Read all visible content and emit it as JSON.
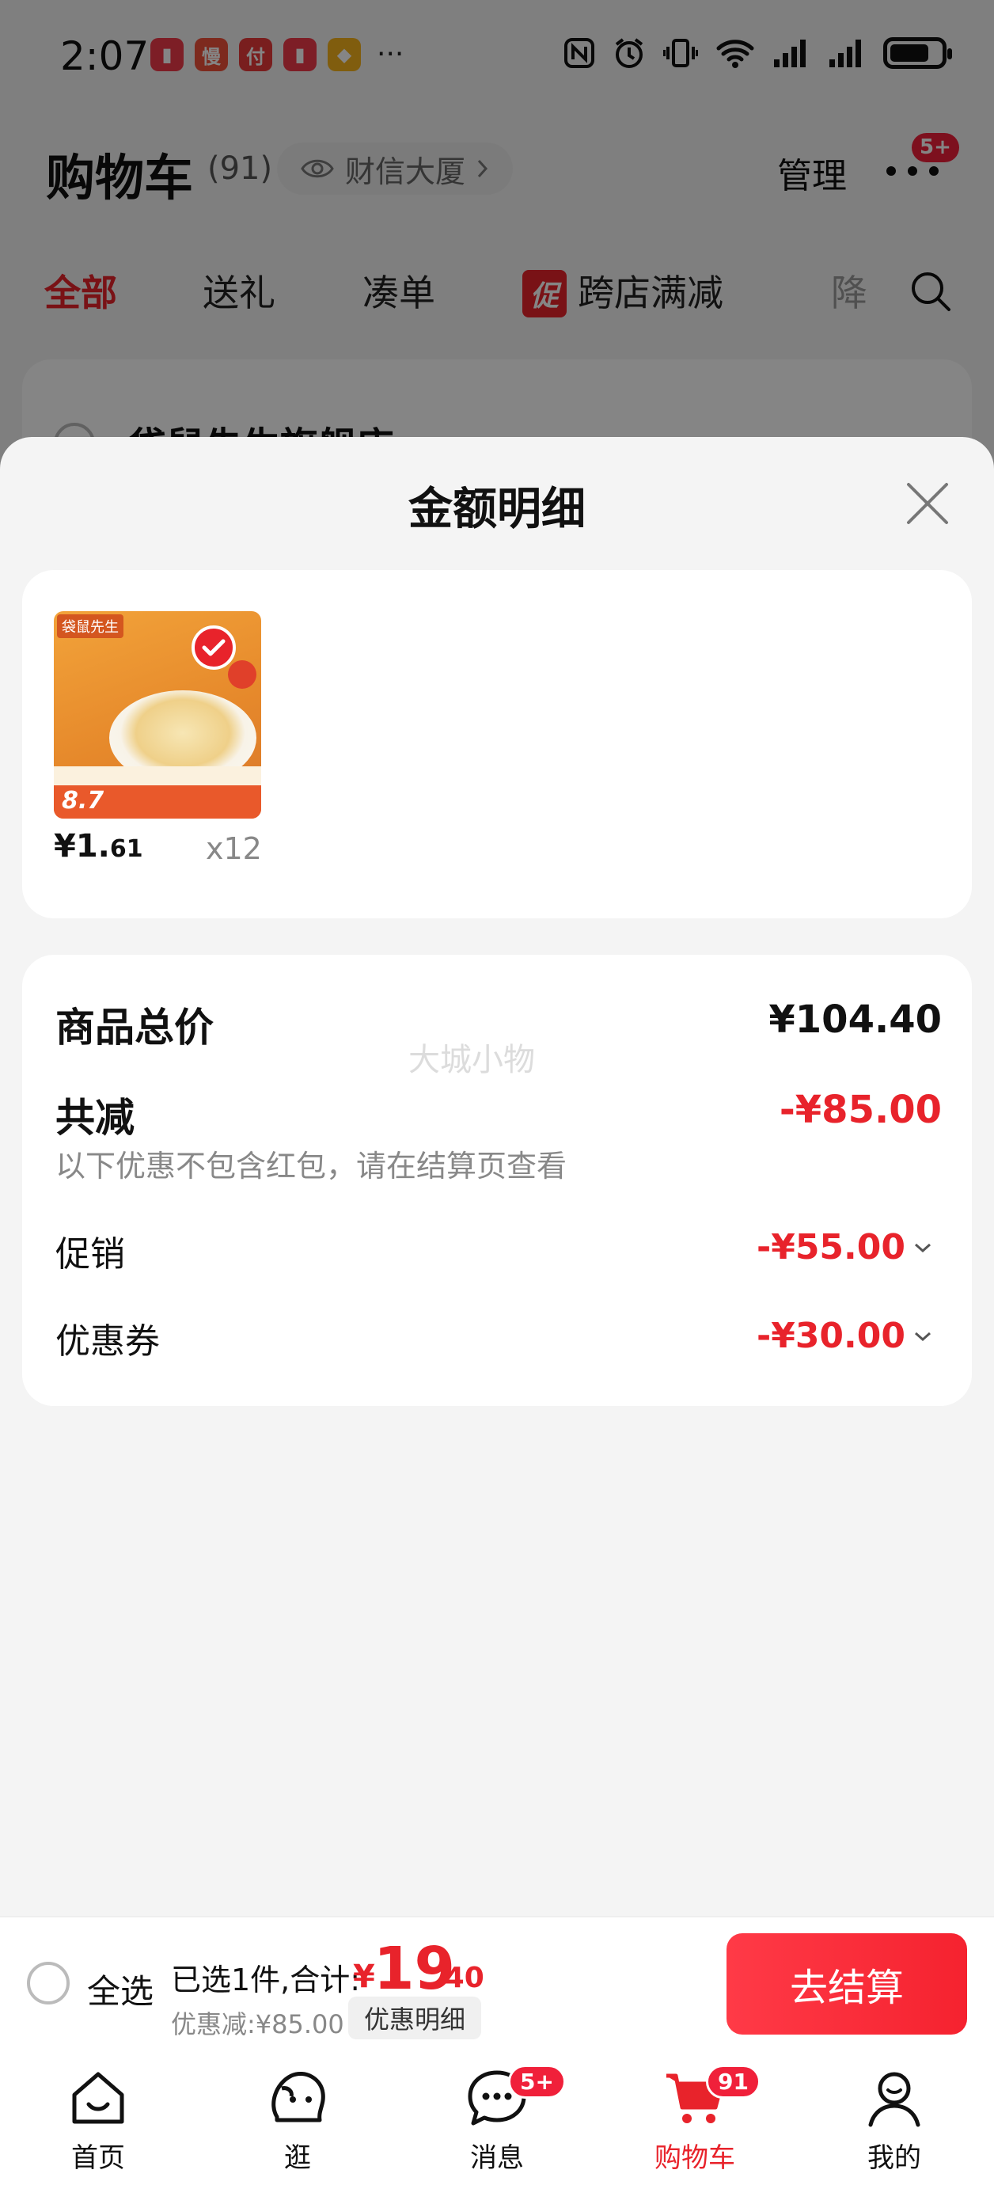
{
  "status_bar": {
    "time": "2:07",
    "app_icons": [
      {
        "name": "book-app-icon",
        "glyph": "▮",
        "color": "#ef3b4a"
      },
      {
        "name": "slow-app-icon",
        "glyph": "慢",
        "color": "#f0523a"
      },
      {
        "name": "pay-app-icon",
        "glyph": "付",
        "color": "#e83a3a"
      },
      {
        "name": "book-app-icon-2",
        "glyph": "▮",
        "color": "#ef3b4a"
      },
      {
        "name": "diamond-app-icon",
        "glyph": "◆",
        "color": "#f5b21c"
      }
    ],
    "more": "···"
  },
  "header": {
    "title": "购物车",
    "count": "(91)",
    "location": "财信大厦",
    "manage": "管理",
    "more_badge": "5+"
  },
  "tabs": [
    {
      "label": "全部",
      "active": true
    },
    {
      "label": "送礼",
      "active": false
    },
    {
      "label": "凑单",
      "active": false
    },
    {
      "label": "跨店满减",
      "tag": "促",
      "active": false
    },
    {
      "label": "降",
      "active": false
    }
  ],
  "background_card": {
    "store_name": "袋鼠先生旗舰店"
  },
  "sheet": {
    "title": "金额明细",
    "product": {
      "shop_label": "袋鼠先生",
      "img_price": "8.7",
      "price_int": "¥1.",
      "price_dec": "61",
      "quantity": "x12"
    },
    "summary": {
      "total_label": "商品总价",
      "total_value": "¥104.40",
      "discount_label": "共减",
      "discount_value": "-¥85.00",
      "discount_note": "以下优惠不包含红包，请在结算页查看",
      "promo_label": "促销",
      "promo_value": "-¥55.00",
      "coupon_label": "优惠券",
      "coupon_value": "-¥30.00",
      "watermark": "大城小物"
    }
  },
  "checkout": {
    "select_all": "全选",
    "selected_text": "已选1件,合计:",
    "currency": "¥",
    "total_int": "19",
    "total_dec": ".40",
    "discount_text": "优惠减:¥85.00",
    "detail_label": "优惠明细",
    "checkout_label": "去结算"
  },
  "tab_bar": {
    "items": [
      {
        "label": "首页",
        "icon": "home-icon"
      },
      {
        "label": "逛",
        "icon": "browse-icon"
      },
      {
        "label": "消息",
        "icon": "message-icon",
        "badge": "5+"
      },
      {
        "label": "购物车",
        "icon": "cart-icon",
        "badge": "91",
        "active": true
      },
      {
        "label": "我的",
        "icon": "profile-icon"
      }
    ]
  },
  "colors": {
    "accent": "#e8232b",
    "overlay": "rgba(0,0,0,0.48)"
  }
}
